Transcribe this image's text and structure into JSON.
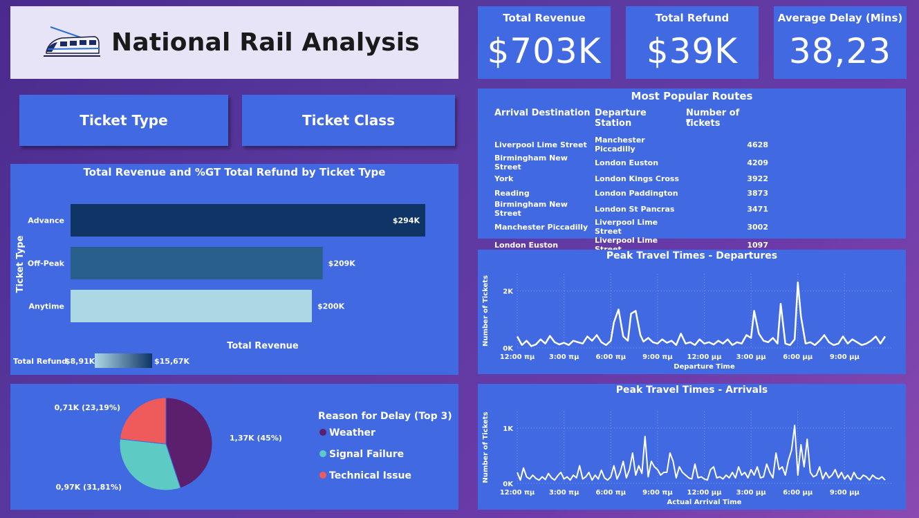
{
  "header": {
    "title": "National Rail Analysis"
  },
  "kpis": [
    {
      "label": "Total Revenue",
      "value": "$703K"
    },
    {
      "label": "Total Refund",
      "value": "$39K"
    },
    {
      "label": "Average Delay (Mins)",
      "value": "38,23"
    }
  ],
  "slicers": {
    "ticket_type": "Ticket Type",
    "ticket_class": "Ticket Class"
  },
  "routes": {
    "title": "Most Popular Routes",
    "columns": [
      "Arrival Destination",
      "Departure Station",
      "Number of tickets"
    ],
    "sort_indicator": "▼",
    "rows": [
      [
        "Liverpool Lime Street",
        "Manchester Piccadilly",
        "4628"
      ],
      [
        "Birmingham New Street",
        "London Euston",
        "4209"
      ],
      [
        "York",
        "London Kings Cross",
        "3922"
      ],
      [
        "Reading",
        "London Paddington",
        "3873"
      ],
      [
        "Birmingham New Street",
        "London St Pancras",
        "3471"
      ],
      [
        "Manchester Piccadilly",
        "Liverpool Lime Street",
        "3002"
      ],
      [
        "London Euston",
        "Liverpool Lime Street",
        "1097"
      ]
    ]
  },
  "colors": {
    "panel": "#4169e1",
    "weather": "#5b1f6e",
    "signal": "#5ecac4",
    "technical": "#ef5a5a",
    "bar_dark": "#0e3566",
    "bar_mid": "#285f8c",
    "bar_light": "#acd8e6"
  },
  "chart_data": [
    {
      "type": "bar",
      "title": "Total Revenue and %GT Total Refund by Ticket Type",
      "ylabel": "Ticket Type",
      "xlabel": "Total Revenue",
      "categories": [
        "Advance",
        "Off-Peak",
        "Anytime"
      ],
      "values": [
        294,
        209,
        200
      ],
      "data_labels": [
        "$294K",
        "$209K",
        "$200K"
      ],
      "color_legend": {
        "title": "Total Refund",
        "min": "$8,91K",
        "max": "$15,67K"
      }
    },
    {
      "type": "pie",
      "legend_title": "Reason for Delay (Top 3)",
      "legend_placement": "right",
      "slices": [
        {
          "name": "Weather",
          "value": 1.37,
          "label": "1,37K (45%)"
        },
        {
          "name": "Signal Failure",
          "value": 0.97,
          "label": "0,97K (31,81%)"
        },
        {
          "name": "Technical Issue",
          "value": 0.71,
          "label": "0,71K (23,19%)"
        }
      ]
    },
    {
      "type": "line",
      "title": "Peak Travel Times - Departures",
      "xlabel": "Departure Time",
      "ylabel": "Number of Tickets",
      "x_ticks": [
        "12:00 πμ",
        "3:00 πμ",
        "6:00 πμ",
        "9:00 πμ",
        "12:00 μμ",
        "3:00 μμ",
        "6:00 μμ",
        "9:00 μμ"
      ],
      "y_ticks": [
        "0K",
        "2K"
      ],
      "ylim": [
        0,
        2600
      ],
      "x_hours": [
        0,
        0.3,
        0.6,
        0.9,
        1.2,
        1.5,
        1.8,
        2.1,
        2.4,
        2.7,
        3.0,
        3.3,
        3.6,
        3.9,
        4.2,
        4.5,
        4.8,
        5.1,
        5.4,
        5.7,
        6.0,
        6.2,
        6.5,
        6.8,
        7.1,
        7.3,
        7.6,
        7.9,
        8.1,
        8.4,
        8.7,
        9.0,
        9.3,
        9.6,
        9.9,
        10.2,
        10.5,
        10.8,
        11.1,
        11.4,
        11.7,
        12.0,
        12.3,
        12.6,
        12.9,
        13.2,
        13.5,
        13.8,
        14.1,
        14.4,
        14.7,
        15.0,
        15.2,
        15.5,
        15.8,
        16.1,
        16.4,
        16.7,
        16.9,
        17.2,
        17.5,
        17.8,
        18.0,
        18.2,
        18.5,
        18.8,
        19.1,
        19.4,
        19.7,
        20.0,
        20.3,
        20.6,
        20.9,
        21.2,
        21.5,
        21.8,
        22.1,
        22.4,
        22.7,
        23.0,
        23.3,
        23.6
      ],
      "values": [
        400,
        100,
        250,
        60,
        120,
        300,
        150,
        420,
        200,
        120,
        180,
        100,
        250,
        200,
        150,
        400,
        250,
        450,
        200,
        100,
        250,
        900,
        1350,
        400,
        250,
        1200,
        1300,
        450,
        220,
        350,
        200,
        150,
        300,
        180,
        250,
        100,
        500,
        150,
        200,
        100,
        300,
        150,
        200,
        120,
        250,
        150,
        300,
        100,
        200,
        150,
        450,
        350,
        1300,
        500,
        250,
        200,
        350,
        150,
        1550,
        150,
        100,
        300,
        2300,
        1100,
        150,
        200,
        100,
        250,
        450,
        200,
        100,
        150,
        400,
        150,
        300,
        200,
        100,
        150,
        250,
        400,
        150,
        400
      ]
    },
    {
      "type": "line",
      "title": "Peak Travel Times - Arrivals",
      "xlabel": "Actual Arrival Time",
      "ylabel": "Number of Tickets",
      "x_ticks": [
        "12:00 πμ",
        "3:00 πμ",
        "6:00 πμ",
        "9:00 πμ",
        "12:00 μμ",
        "3:00 μμ",
        "6:00 μμ",
        "9:00 μμ"
      ],
      "y_ticks": [
        "0K",
        "1K"
      ],
      "ylim": [
        0,
        1300
      ],
      "x_hours": [
        0,
        0.2,
        0.4,
        0.6,
        0.8,
        1.0,
        1.2,
        1.4,
        1.6,
        1.8,
        2.0,
        2.2,
        2.4,
        2.6,
        2.8,
        3.0,
        3.2,
        3.4,
        3.6,
        3.8,
        4.0,
        4.2,
        4.4,
        4.6,
        4.8,
        5.0,
        5.2,
        5.4,
        5.6,
        5.8,
        6.0,
        6.2,
        6.4,
        6.6,
        6.8,
        7.0,
        7.2,
        7.4,
        7.6,
        7.8,
        8.0,
        8.2,
        8.4,
        8.6,
        8.8,
        9.0,
        9.2,
        9.4,
        9.6,
        9.8,
        10.0,
        10.2,
        10.4,
        10.6,
        10.8,
        11.0,
        11.2,
        11.4,
        11.6,
        11.8,
        12.0,
        12.2,
        12.4,
        12.6,
        12.8,
        13.0,
        13.2,
        13.4,
        13.6,
        13.8,
        14.0,
        14.2,
        14.4,
        14.6,
        14.8,
        15.0,
        15.2,
        15.4,
        15.6,
        15.8,
        16.0,
        16.2,
        16.4,
        16.6,
        16.8,
        17.0,
        17.2,
        17.4,
        17.6,
        17.8,
        18.0,
        18.2,
        18.4,
        18.6,
        18.8,
        19.0,
        19.2,
        19.4,
        19.6,
        19.8,
        20.0,
        20.2,
        20.4,
        20.6,
        20.8,
        21.0,
        21.2,
        21.4,
        21.6,
        21.8,
        22.0,
        22.2,
        22.4,
        22.6,
        22.8,
        23.0,
        23.2,
        23.4,
        23.6
      ],
      "values": [
        200,
        60,
        280,
        120,
        80,
        150,
        90,
        60,
        120,
        70,
        180,
        100,
        60,
        140,
        200,
        80,
        120,
        60,
        150,
        100,
        320,
        80,
        120,
        200,
        60,
        150,
        80,
        240,
        100,
        60,
        120,
        320,
        80,
        200,
        400,
        100,
        250,
        550,
        150,
        320,
        180,
        850,
        120,
        400,
        300,
        250,
        150,
        200,
        200,
        550,
        400,
        100,
        300,
        200,
        150,
        100,
        80,
        350,
        100,
        120,
        80,
        60,
        250,
        300,
        100,
        120,
        80,
        150,
        100,
        200,
        100,
        300,
        150,
        200,
        100,
        250,
        150,
        300,
        100,
        120,
        350,
        200,
        100,
        550,
        250,
        300,
        150,
        420,
        600,
        1050,
        150,
        700,
        300,
        800,
        200,
        120,
        150,
        300,
        80,
        200,
        100,
        150,
        250,
        100,
        200,
        80,
        150,
        60,
        200,
        100,
        80,
        150,
        120,
        60,
        150,
        100,
        80,
        120,
        60
      ]
    }
  ]
}
